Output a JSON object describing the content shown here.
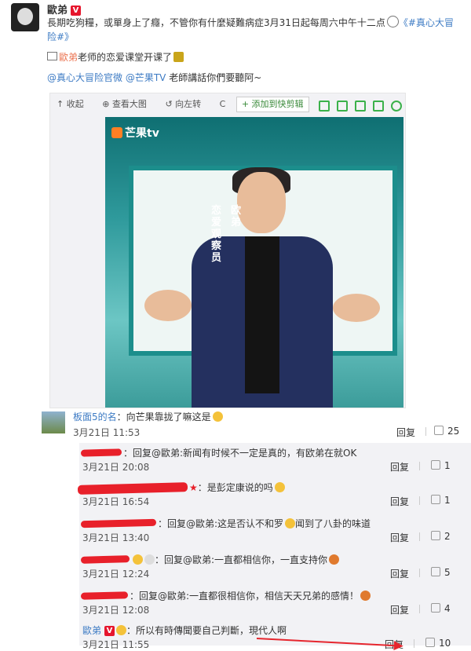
{
  "post": {
    "author": "歐弟",
    "author_badge": "V",
    "line1": "長期吃狗糧，或單身上了癮，不管你有什麼疑難病症3月31日起每周六中午十二点",
    "hashtag_a": "《#真心大冒",
    "hashtag_b": "险#》",
    "line2_prefix": "歐弟",
    "line2_suffix": "老师的恋爱课堂开课了",
    "mention1": "@真心大冒险官微",
    "mention2": "@芒果TV",
    "line3_suffix": " 老師講話你們要聽阿~"
  },
  "media": {
    "toolbar": [
      "收起",
      "查看大图",
      "向左转",
      "C"
    ],
    "add_label": "+ 添加到快剪辑",
    "logo": "芒果tv",
    "poster_vertical1": "恋爱观察员",
    "poster_vertical2": "欧弟"
  },
  "comments": [
    {
      "name": "板面5的名",
      "text": "：向芒果靠拢了嘛这是",
      "time": "3月21日 11:53",
      "reply": "回复",
      "likes": "25"
    },
    {
      "text": "：回复@歐弟:新闻有时候不一定是真的，有欧弟在就OK",
      "time": "3月21日 20:08",
      "reply": "回复",
      "likes": "1"
    },
    {
      "text": "：是彭定康说的吗",
      "time": "3月21日 16:54",
      "reply": "回复",
      "likes": "1"
    },
    {
      "text": "：回复@歐弟:这是否认不和罗",
      "text2": "闻到了八卦的味道",
      "time": "3月21日 13:40",
      "reply": "回复",
      "likes": "2"
    },
    {
      "text": "：回复@歐弟:一直都相信你，一直支持你",
      "time": "3月21日 12:24",
      "reply": "回复",
      "likes": "5"
    },
    {
      "text": "：回复@歐弟:一直都很相信你，相信天天兄弟的感情！",
      "time": "3月21日 12:08",
      "reply": "回复",
      "likes": "4"
    },
    {
      "name": "歐弟",
      "text": "：所以有時傳聞要自己判斷，現代人啊",
      "time": "3月21日 11:55",
      "reply": "回复",
      "likes": "10"
    }
  ],
  "colors": {
    "accent": "#eb7350",
    "link": "#3d7bc4",
    "redact": "#e8202a",
    "arrow": "#e6262e"
  }
}
